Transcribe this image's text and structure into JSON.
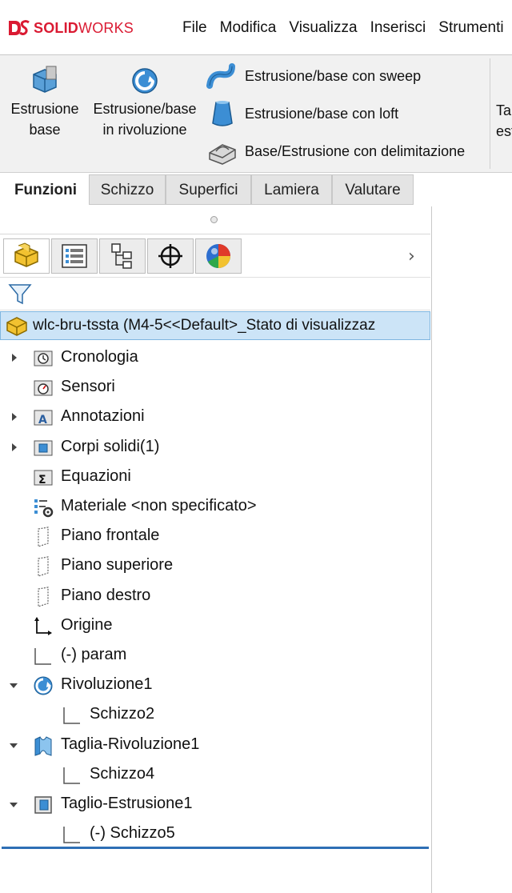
{
  "app": {
    "logo_brand": "SOLID",
    "logo_brand_light": "WORKS"
  },
  "menu": [
    "File",
    "Modifica",
    "Visualizza",
    "Inserisci",
    "Strumenti"
  ],
  "commands": {
    "extrude": {
      "label_line1": "Estrusione",
      "label_line2": "base"
    },
    "revolve": {
      "label_line1": "Estrusione/base",
      "label_line2": "in rivoluzione"
    },
    "sweep": "Estrusione/base con sweep",
    "loft": "Estrusione/base con loft",
    "boundary": "Base/Estrusione con delimitazione",
    "partial_line1": "Ta",
    "partial_line2": "est"
  },
  "tabs": [
    "Funzioni",
    "Schizzo",
    "Superfici",
    "Lamiera",
    "Valutare"
  ],
  "active_tab": "Funzioni",
  "feature_manager": {
    "panel_tabs": [
      "featuremanager-icon",
      "propertymanager-icon",
      "configurationmanager-icon",
      "dimxpert-icon",
      "display-manager-icon"
    ],
    "root": "wlc-bru-tssta  (M4-5<<Default>_Stato di visualizzaz",
    "tree": [
      {
        "label": "Cronologia",
        "icon": "history-icon",
        "expander": "closed",
        "indent": 0
      },
      {
        "label": "Sensori",
        "icon": "sensors-icon",
        "expander": "none",
        "indent": 0
      },
      {
        "label": "Annotazioni",
        "icon": "annotations-icon",
        "expander": "closed",
        "indent": 0
      },
      {
        "label": "Corpi solidi(1)",
        "icon": "solid-bodies-icon",
        "expander": "closed",
        "indent": 0
      },
      {
        "label": "Equazioni",
        "icon": "equations-icon",
        "expander": "none",
        "indent": 0
      },
      {
        "label": "Materiale <non specificato>",
        "icon": "material-icon",
        "expander": "none",
        "indent": 0
      },
      {
        "label": "Piano frontale",
        "icon": "plane-icon",
        "expander": "none",
        "indent": 0
      },
      {
        "label": "Piano superiore",
        "icon": "plane-icon",
        "expander": "none",
        "indent": 0
      },
      {
        "label": "Piano destro",
        "icon": "plane-icon",
        "expander": "none",
        "indent": 0
      },
      {
        "label": "Origine",
        "icon": "origin-icon",
        "expander": "none",
        "indent": 0
      },
      {
        "label": "(-) param",
        "icon": "sketch-icon",
        "expander": "none",
        "indent": 0
      },
      {
        "label": "Rivoluzione1",
        "icon": "revolve-feature-icon",
        "expander": "open",
        "indent": 0
      },
      {
        "label": "Schizzo2",
        "icon": "sketch-icon",
        "expander": "none",
        "indent": 1
      },
      {
        "label": "Taglia-Rivoluzione1",
        "icon": "cut-revolve-icon",
        "expander": "open",
        "indent": 0
      },
      {
        "label": "Schizzo4",
        "icon": "sketch-icon",
        "expander": "none",
        "indent": 1
      },
      {
        "label": "Taglio-Estrusione1",
        "icon": "cut-extrude-icon",
        "expander": "open",
        "indent": 0
      },
      {
        "label": "(-) Schizzo5",
        "icon": "sketch-icon",
        "expander": "none",
        "indent": 1
      }
    ]
  }
}
